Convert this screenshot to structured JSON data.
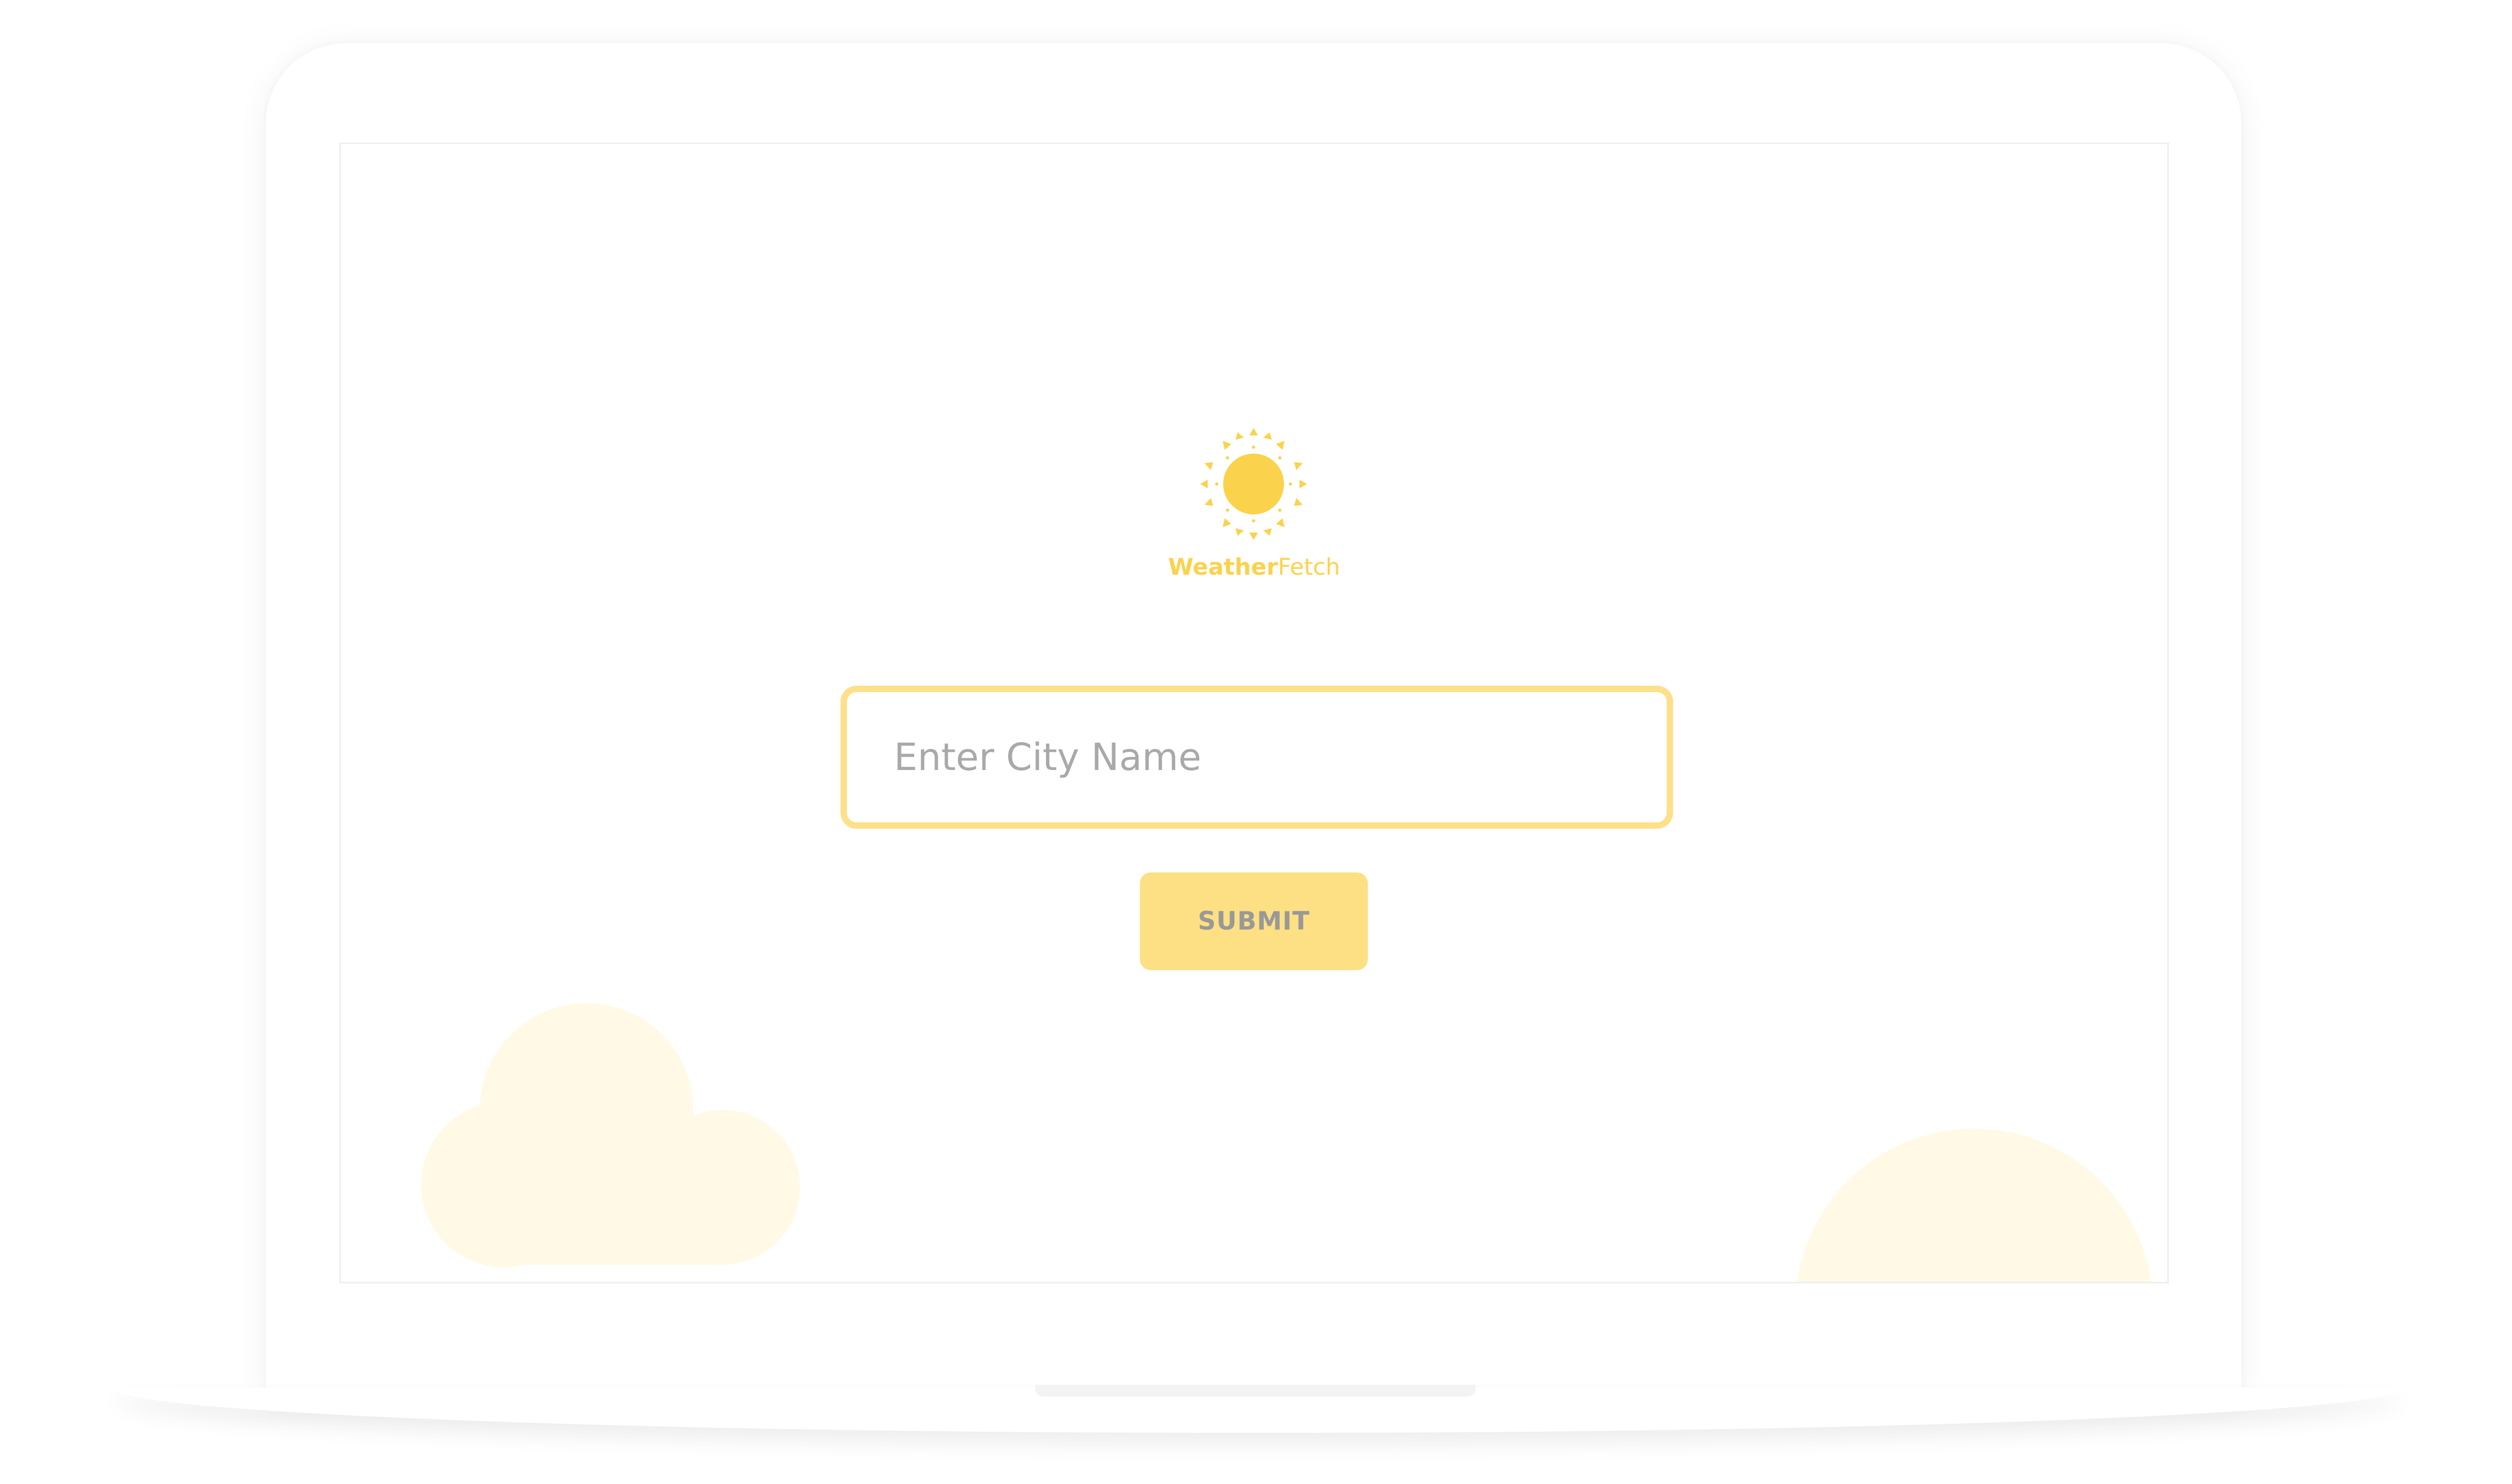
{
  "brand": {
    "name_bold": "Weather",
    "name_light": "Fetch",
    "logo_icon": "sun-icon"
  },
  "search": {
    "placeholder": "Enter City Name",
    "value": ""
  },
  "submit": {
    "label": "SUBMIT"
  },
  "decor": {
    "cloud_icon": "cloud-icon",
    "corner_sun_icon": "sun-icon"
  },
  "colors": {
    "accent": "#fbd24c",
    "input_border": "#fde08a",
    "button_bg": "#fde083",
    "button_text": "#999999",
    "placeholder": "#a9a9a9",
    "decor_fill": "#fff9e6"
  }
}
